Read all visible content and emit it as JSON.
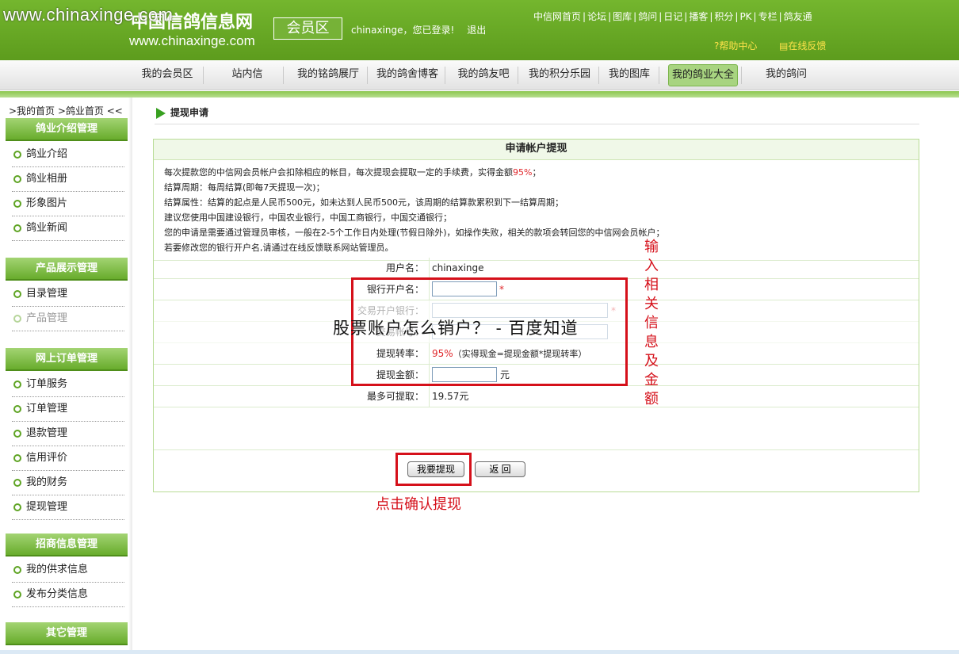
{
  "watermark": "www.chinaxinge.com",
  "header": {
    "logo_cn": "中国信鸽信息网",
    "logo_en": "www.chinaxinge.com",
    "member_area": "会员区",
    "login_status": "chinaxinge，您已登录!",
    "logout": "退出",
    "top_links": [
      "中信网首页",
      "论坛",
      "图库",
      "鸽问",
      "日记",
      "播客",
      "积分",
      "PK",
      "专栏",
      "鸽友通"
    ],
    "help": "帮助中心",
    "feedback": "在线反馈"
  },
  "nav": {
    "items": [
      {
        "label": "我的会员区"
      },
      {
        "label": "站内信"
      },
      {
        "label": "我的铭鸽展厅"
      },
      {
        "label": "我的鸽舍博客"
      },
      {
        "label": "我的鸽友吧"
      },
      {
        "label": "我的积分乐园"
      },
      {
        "label": "我的图库"
      },
      {
        "label": "我的鸽业大全",
        "active": true
      },
      {
        "label": "我的鸽问"
      }
    ]
  },
  "sidebar": {
    "breadcrumb": ">我的首页 >鸽业首页 <<",
    "sections": [
      {
        "title": "鸽业介绍管理",
        "items": [
          "鸽业介绍",
          "鸽业相册",
          "形象图片",
          "鸽业新闻"
        ]
      },
      {
        "title": "产品展示管理",
        "items": [
          "目录管理",
          "产品管理"
        ]
      },
      {
        "title": "网上订单管理",
        "items": [
          "订单服务",
          "订单管理",
          "退款管理",
          "信用评价",
          "我的财务",
          "提现管理"
        ]
      },
      {
        "title": "招商信息管理",
        "items": [
          "我的供求信息",
          "发布分类信息"
        ]
      },
      {
        "title": "其它管理",
        "items": []
      }
    ]
  },
  "page": {
    "title": "提现申请",
    "panel_title": "申请帐户提现",
    "notes": [
      "每次提款您的中信网会员帐户会扣除相应的帐目，每次提现会提取一定的手续费，实得金额95%；",
      "结算周期：每周结算(即每7天提现一次)；",
      "结算属性：结算的起点是人民币500元，如未达到人民币500元，该周期的结算款累积到下一结算周期；",
      "建议您使用中国建设银行，中国农业银行，中国工商银行，中国交通银行；",
      "您的申请是需要通过管理员审核，一般在2-5个工作日内处理(节假日除外)，如操作失败，相关的款项会转回您的中信网会员帐户；",
      "若要修改您的银行开户名,请通过在线反馈联系网站管理员。"
    ],
    "note0_prefix": "每次提款您的中信网会员帐户会扣除相应的帐目，每次提现会提取一定的手续费，实得金额",
    "note0_pct": "95%",
    "note0_suffix": "；",
    "form": {
      "username_label": "用户名：",
      "username_value": "chinaxinge",
      "bank_name_label": "银行开户名：",
      "bank_name_value": "",
      "bank_label": "交易开户银行：",
      "account_label": "交易帐号：",
      "rate_label": "提现转率：",
      "rate_value": "95%",
      "rate_note": "（实得现金=提现金额*提现转率）",
      "amount_label": "提现金额：",
      "amount_value": "",
      "amount_unit": "元",
      "max_label": "最多可提取：",
      "max_value": "19.57元",
      "required_mark": "*"
    },
    "submit_button": "我要提现",
    "back_button": "返 回"
  },
  "annotations": {
    "overlay_title": "股票账户怎么销户？ - 百度知道",
    "side_note": "输入相关信息及金额",
    "click_note": "点击确认提现",
    "color": "#d5101a"
  }
}
